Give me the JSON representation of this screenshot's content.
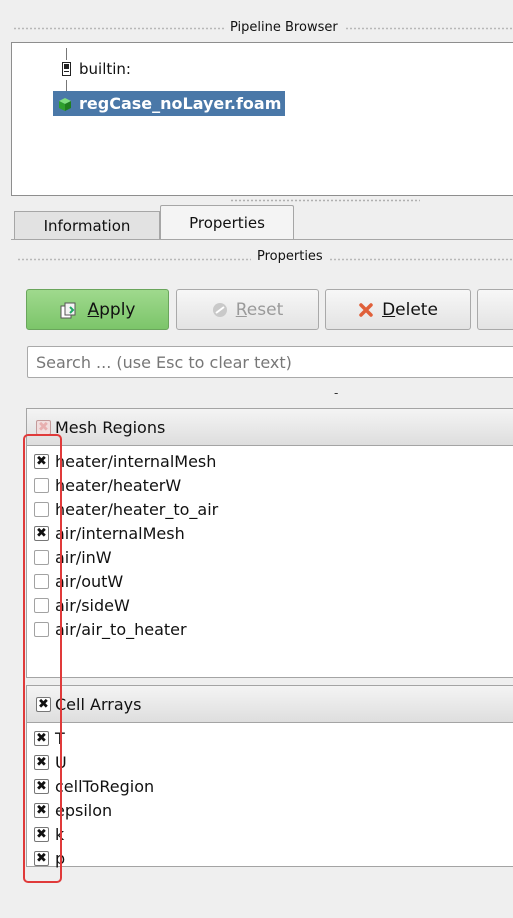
{
  "pipeline_browser": {
    "title": "Pipeline Browser",
    "root_label": "builtin:",
    "source_label": "regCase_noLayer.foam",
    "icons": [
      "server-icon",
      "cube-icon"
    ]
  },
  "tabs": [
    {
      "label": "Information",
      "active": false
    },
    {
      "label": "Properties",
      "active": true
    }
  ],
  "properties_panel": {
    "title": "Properties"
  },
  "buttons": {
    "apply_label_u": "A",
    "apply_label_rest": "pply",
    "reset_label_u": "R",
    "reset_label_rest": "eset",
    "delete_label_u": "D",
    "delete_label_rest": "elete",
    "apply_color": "#8fcf7d",
    "delete_icon_color": "#e0603a"
  },
  "search": {
    "placeholder": "Search ... (use Esc to clear text)",
    "value": ""
  },
  "separator_mark": "-",
  "mesh_regions": {
    "header": "Mesh Regions",
    "header_state": "partial",
    "items": [
      {
        "label": "heater/internalMesh",
        "checked": true
      },
      {
        "label": "heater/heaterW",
        "checked": false
      },
      {
        "label": "heater/heater_to_air",
        "checked": false
      },
      {
        "label": "air/internalMesh",
        "checked": true
      },
      {
        "label": "air/inW",
        "checked": false
      },
      {
        "label": "air/outW",
        "checked": false
      },
      {
        "label": "air/sideW",
        "checked": false
      },
      {
        "label": "air/air_to_heater",
        "checked": false
      }
    ]
  },
  "cell_arrays": {
    "header": "Cell Arrays",
    "header_state": "checked",
    "items": [
      {
        "label": "T",
        "checked": true
      },
      {
        "label": "U",
        "checked": true
      },
      {
        "label": "cellToRegion",
        "checked": true
      },
      {
        "label": "epsilon",
        "checked": true
      },
      {
        "label": "k",
        "checked": true
      },
      {
        "label": "p",
        "checked": true
      }
    ]
  },
  "check_glyph": "✖",
  "highlight_color": "#e03a3a"
}
